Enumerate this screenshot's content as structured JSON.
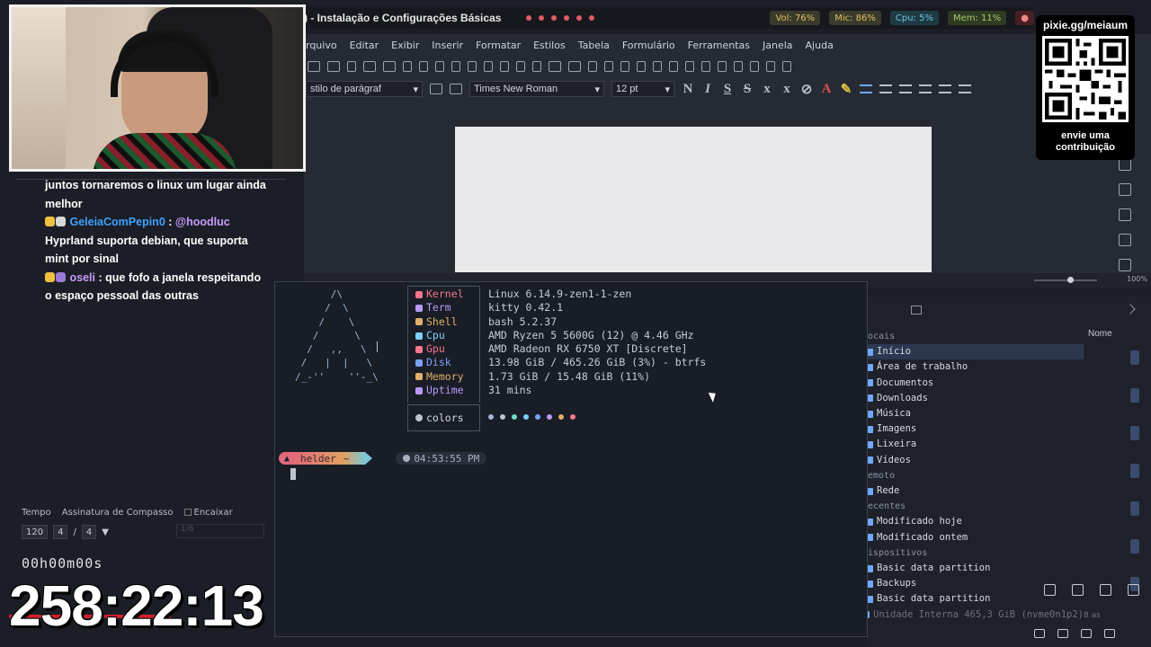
{
  "topbar": {
    "window_title": ") - Instalação e Configurações Básicas",
    "vol": "Vol: 76%",
    "mic": "Mic: 86%",
    "cpu": "Cpu: 5%",
    "mem": "Mem: 11%"
  },
  "office": {
    "menu": [
      "rquivo",
      "Editar",
      "Exibir",
      "Inserir",
      "Formatar",
      "Estilos",
      "Tabela",
      "Formulário",
      "Ferramentas",
      "Janela",
      "Ajuda"
    ],
    "paragraph_style": "stilo de parágraf",
    "font_name": "Times New Roman",
    "font_size": "12 pt",
    "zoom": "100%"
  },
  "chat": {
    "line1": "juntos tornaremos o linux um lugar ainda melhor",
    "user2": "GeleiaComPepin0",
    "mention2": "@hoodluc",
    "line2": "Hyprland suporta debian, que suporta mint por sinal",
    "user3": "oseli",
    "line3": "que fofo a janela respeitando o espaço pessoal das outras",
    "colors": {
      "user2": "#3da0ff",
      "mention2": "#c89cff",
      "user3": "#c89cff"
    }
  },
  "daw": {
    "tempo_label": "Tempo",
    "signature_label": "Assinatura de Compasso",
    "snap_label": "Encaixar",
    "bpm": "120",
    "sig_num": "4",
    "sig_sep": "/",
    "sig_den": "4",
    "ghost": "1/8",
    "timecode": "00h00m00s"
  },
  "stream_timer": "258:22:13",
  "terminal": {
    "modules": [
      {
        "label": "Kernel",
        "color": "#f7768e",
        "value": "Linux 6.14.9-zen1-1-zen"
      },
      {
        "label": "Term",
        "color": "#bb9af7",
        "value": "kitty 0.42.1"
      },
      {
        "label": "Shell",
        "color": "#e0af68",
        "value": "bash 5.2.37"
      },
      {
        "label": "Cpu",
        "color": "#7dcfff",
        "value": "AMD Ryzen 5 5600G (12) @ 4.46 GHz"
      },
      {
        "label": "Gpu",
        "color": "#f7768e",
        "value": "AMD Radeon RX 6750 XT [Discrete]"
      },
      {
        "label": "Disk",
        "color": "#7aa2f7",
        "value": "13.98 GiB / 465.26 GiB (3%) - btrfs"
      },
      {
        "label": "Memory",
        "color": "#e0af68",
        "value": "1.73 GiB / 15.48 GiB (11%)"
      },
      {
        "label": "Uptime",
        "color": "#bb9af7",
        "value": "31 mins"
      }
    ],
    "colors_label": "colors",
    "swatches": [
      "#a9b1d6",
      "#c0c4cc",
      "#73daca",
      "#7dcfff",
      "#7aa2f7",
      "#bb9af7",
      "#e0af68",
      "#f7768e"
    ],
    "prompt_user": "helder",
    "prompt_dir": "~",
    "clock": "04:53:55 PM"
  },
  "files": {
    "column_header": "Nome",
    "sections": [
      {
        "title": "ocais",
        "items": [
          "Início",
          "Área de trabalho",
          "Documentos",
          "Downloads",
          "Música",
          "Imagens",
          "Lixeira",
          "Vídeos"
        ]
      },
      {
        "title": "emoto",
        "items": [
          "Rede"
        ]
      },
      {
        "title": "ecentes",
        "items": [
          "Modificado hoje",
          "Modificado ontem"
        ]
      },
      {
        "title": "ispositivos",
        "items": [
          "Basic data partition",
          "Backups",
          "Basic data partition",
          "Unidade Interna 465,3 GiB (nvme0n1p2)"
        ]
      }
    ],
    "selected_item": "Início",
    "size_hint": "8 as"
  },
  "qr": {
    "title": "pixie.gg/meiaum",
    "caption_line1": "envie uma",
    "caption_line2": "contribuição"
  }
}
